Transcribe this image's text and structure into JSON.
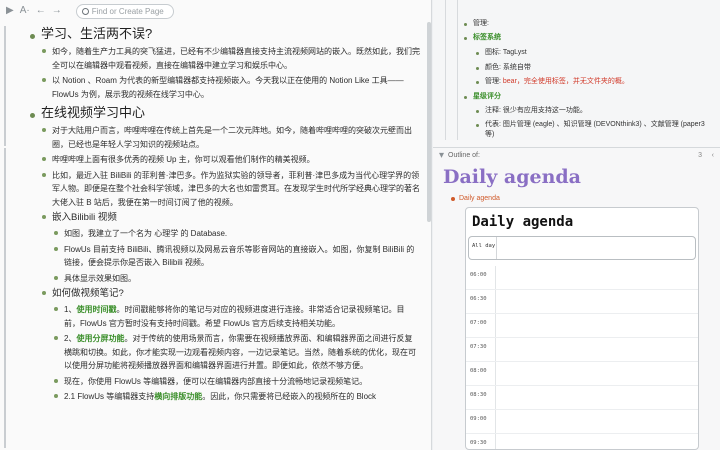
{
  "toolbar": {
    "search_placeholder": "Find or Create Page"
  },
  "left": {
    "h1": "学习、生活两不误?",
    "p1": "如今，随着生产力工具的突飞猛进，已经有不少编辑器直接支持主流视频网站的嵌入。既然如此，我们完全可以在编辑器中观看视频，直接在编辑器中建立学习和娱乐中心。",
    "p2": "以 Notion 、Roam 为代表的新型编辑器都支持视频嵌入。今天我以正在使用的 Notion Like 工具—— FlowUs 为例，展示我的视频在线学习中心。",
    "h2": "在线视频学习中心",
    "p3": "对于大陆用户而言，哔哩哔哩在传统上首先是一个二次元阵地。如今，随着哔哩哔哩的突破次元壁而出圈，已经也是年轻人学习知识的视频站点。",
    "p4": "哔哩哔哩上面有很多优秀的视频 Up 主，你可以观看他们制作的精美视频。",
    "p5": "比如，最近入驻 BiliBili 的菲利普·津巴多。作为监狱实验的领导者，菲利普·津巴多成为当代心理学界的领军人物。即便是在整个社会科学领域，津巴多的大名也如雷贯耳。在发现学生时代所学经典心理学的著名大佬入驻 B 站后，我便在第一时间订阅了他的视频。",
    "h3": "嵌入Bilibili 视频",
    "p6": "如图，我建立了一个名为 心理学 的 Database.",
    "p7": "FlowUs 目前支持 BiliBili、腾讯视频以及网易云音乐等影音网站的直接嵌入。如图，你复制 BiliBili 的链接，便会提示你是否嵌入 Bilibili 视频。",
    "p8": "具体显示效果如图。",
    "h4": "如何做视频笔记?",
    "p9_a": "1、",
    "p9_b": "使用时间戳",
    "p9_c": "。时间戳能够将你的笔记与对应的视频进度进行连接。非常适合记录视频笔记。目前，FlowUs 官方暂时没有支持时间戳。希望 FlowUs 官方后续支持相关功能。",
    "p10_a": "2、",
    "p10_b": "使用分屏功能",
    "p10_c": "。对于传统的使用场景而言，你需要在视频播放界面、和编辑器界面之间进行反复横跳和切换。如此，你才能实现一边观看视频内容，一边记录笔记。当然，随着系统的优化，现在可以使用分屏功能将视频播放器界面和编辑器界面进行并置。即便如此，依然不够方便。",
    "p11": "现在，你使用 FlowUs 等编辑器，便可以在编辑器内部直接十分流畅地记录视频笔记。",
    "p12_a": "2.1 FlowUs 等编辑器支持",
    "p12_b": "横向排版功能",
    "p12_c": "。因此，你只需要将已经嵌入的视频所在的 Block"
  },
  "right": {
    "r1": "管理:",
    "r2": "标签系统",
    "r3": "图标: TagLyst",
    "r4": "颜色: 系统自带",
    "r5_a": "管理: ",
    "r5_b": "bear，完全使用标签，并无文件夹的概。",
    "r6": "星级评分",
    "r7": "注释: 很少有应用支持这一功能。",
    "r8": "代表: 图片管理 (eagle) 、知识管理 (DEVONthink3) 、文献管理 (paper3等)",
    "outline_label": "Outline of:",
    "outline_count": "3",
    "big_title": "Daily agenda",
    "link": "Daily agenda"
  },
  "calendar": {
    "title": "Daily agenda",
    "allday": "All day",
    "slots": [
      "06:00",
      "06:30",
      "07:00",
      "07:30",
      "08:00",
      "08:30",
      "09:00",
      "09:30"
    ]
  }
}
